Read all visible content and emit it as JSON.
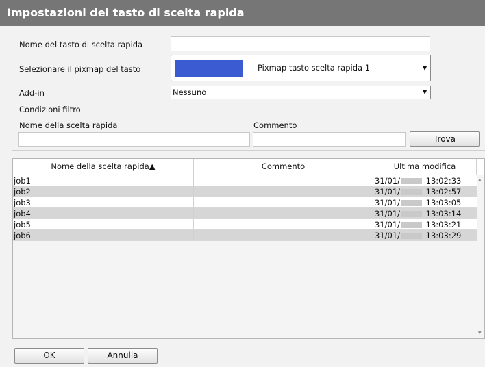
{
  "window": {
    "title": "Impostazioni del tasto di scelta rapida"
  },
  "form": {
    "name_label": "Nome del tasto di scelta rapida",
    "name_value": "",
    "pixmap_label": "Selezionare il pixmap del tasto",
    "pixmap_value": "Pixmap tasto scelta rapida 1",
    "pixmap_color": "#3a5bd1",
    "addin_label": "Add-in",
    "addin_value": "Nessuno"
  },
  "filter": {
    "legend": "Condizioni filtro",
    "name_label": "Nome della scelta rapida",
    "name_value": "",
    "comment_label": "Commento",
    "comment_value": "",
    "search_button": "Trova"
  },
  "table": {
    "headers": [
      "Nome della scelta rapida▲",
      "Commento",
      "Ultima modifica"
    ],
    "rows": [
      {
        "name": "job1",
        "comment": "",
        "date": "31/01/",
        "time": "13:02:33"
      },
      {
        "name": "job2",
        "comment": "",
        "date": "31/01/",
        "time": "13:02:57"
      },
      {
        "name": "job3",
        "comment": "",
        "date": "31/01/",
        "time": "13:03:05"
      },
      {
        "name": "job4",
        "comment": "",
        "date": "31/01/",
        "time": "13:03:14"
      },
      {
        "name": "job5",
        "comment": "",
        "date": "31/01/",
        "time": "13:03:21"
      },
      {
        "name": "job6",
        "comment": "",
        "date": "31/01/",
        "time": "13:03:29"
      }
    ]
  },
  "footer": {
    "ok_button": "OK",
    "cancel_button": "Annulla"
  }
}
